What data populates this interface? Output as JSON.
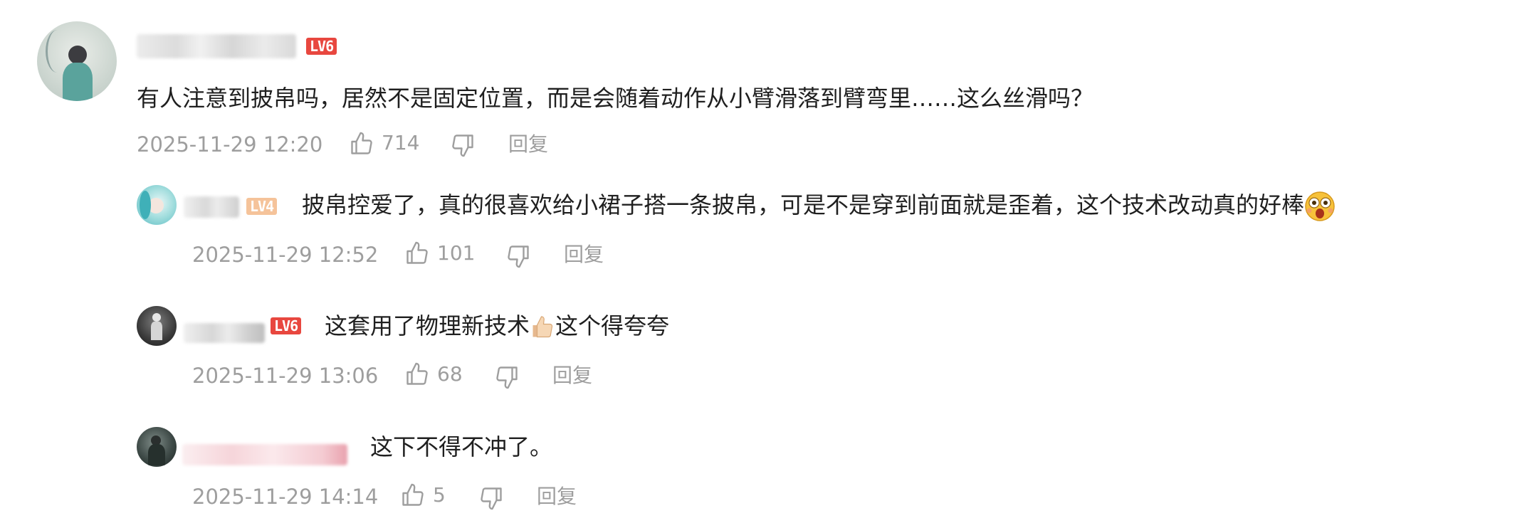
{
  "colors": {
    "text": "#1f1f1f",
    "meta": "#9e9e9e",
    "lv6": "#e8473f",
    "lv4": "#f5c39a"
  },
  "comments": [
    {
      "level": "LV6",
      "text": "有人注意到披帛吗，居然不是固定位置，而是会随着动作从小臂滑落到臂弯里……这么丝滑吗？",
      "time": "2025-11-29 12:20",
      "likes": "714",
      "reply": "回复"
    }
  ],
  "replies": [
    {
      "level": "LV4",
      "text": "披帛控爱了，真的很喜欢给小裙子搭一条披帛，可是不是穿到前面就是歪着，这个技术改动真的好棒",
      "emoji": "astonished-face-icon",
      "time": "2025-11-29 12:52",
      "likes": "101",
      "reply": "回复"
    },
    {
      "level": "LV6",
      "text_before": "这套用了物理新技术",
      "emoji": "thumbs-up-icon",
      "text_after": "这个得夸夸",
      "time": "2025-11-29 13:06",
      "likes": "68",
      "reply": "回复"
    },
    {
      "text": "这下不得不冲了。",
      "time": "2025-11-29 14:14",
      "likes": "5",
      "reply": "回复"
    }
  ]
}
